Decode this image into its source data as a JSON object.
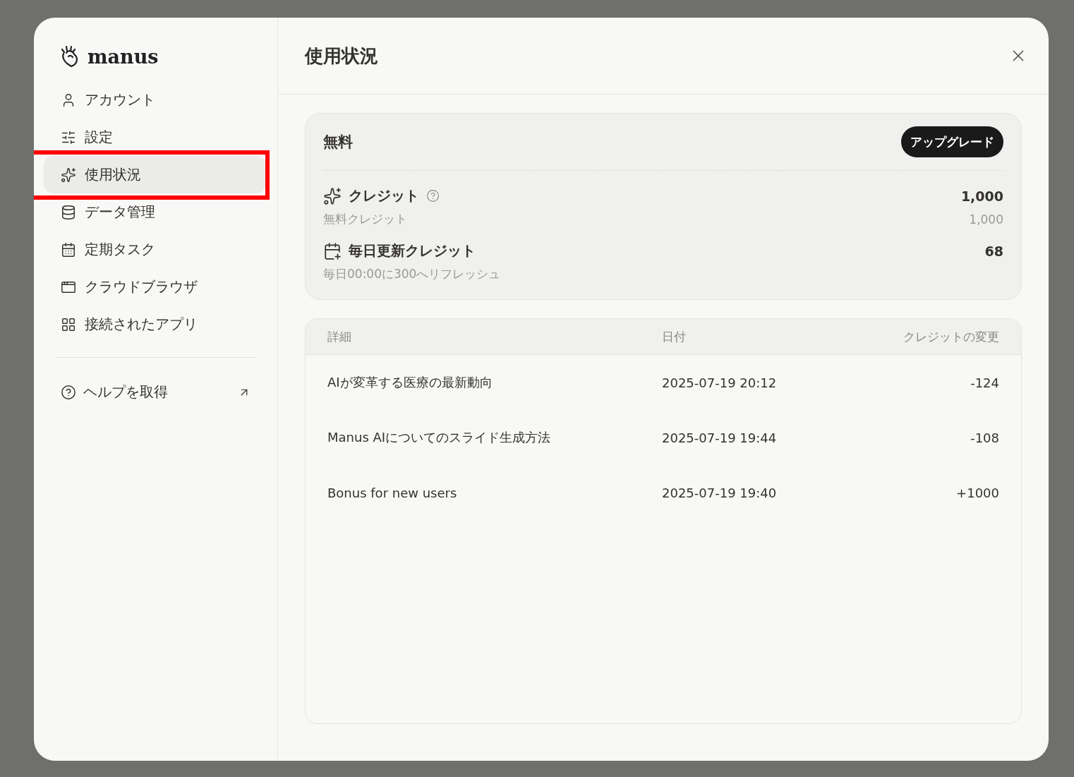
{
  "brand": {
    "name": "manus"
  },
  "sidebar": {
    "items": [
      {
        "label": "アカウント",
        "kind": "account",
        "selected": false
      },
      {
        "label": "設定",
        "kind": "settings",
        "selected": false
      },
      {
        "label": "使用状況",
        "kind": "usage",
        "selected": true
      },
      {
        "label": "データ管理",
        "kind": "data",
        "selected": false
      },
      {
        "label": "定期タスク",
        "kind": "schedule",
        "selected": false
      },
      {
        "label": "クラウドブラウザ",
        "kind": "browser",
        "selected": false
      },
      {
        "label": "接続されたアプリ",
        "kind": "apps",
        "selected": false
      }
    ],
    "help": {
      "label": "ヘルプを取得"
    }
  },
  "header": {
    "title": "使用状況"
  },
  "plan": {
    "name": "無料",
    "upgrade": "アップグレード",
    "credits": {
      "label": "クレジット",
      "value": "1,000",
      "sub_label": "無料クレジット",
      "sub_value": "1,000"
    },
    "daily": {
      "label": "毎日更新クレジット",
      "value": "68",
      "note": "毎日00:00に300へリフレッシュ"
    }
  },
  "table": {
    "columns": [
      "詳細",
      "日付",
      "クレジットの変更"
    ],
    "rows": [
      [
        "AIが変革する医療の最新動向",
        "2025-07-19 20:12",
        "-124"
      ],
      [
        "Manus AIについてのスライド生成方法",
        "2025-07-19 19:44",
        "-108"
      ],
      [
        "Bonus for new users",
        "2025-07-19 19:40",
        "+1000"
      ]
    ]
  }
}
